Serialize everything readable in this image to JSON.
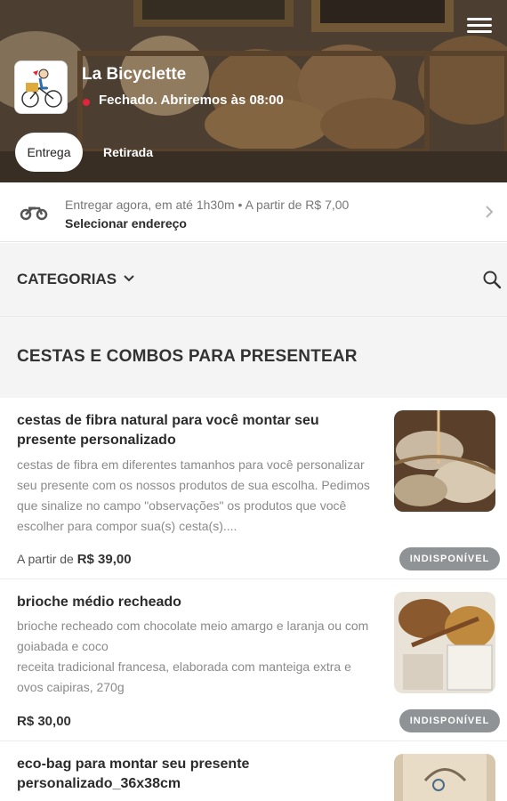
{
  "store": {
    "name": "La Bicyclette",
    "status": "Fechado. Abriremos às 08:00",
    "status_color": "#e2243b"
  },
  "modes": {
    "delivery": "Entrega",
    "pickup": "Retirada"
  },
  "delivery_info": {
    "line1": "Entregar agora, em até 1h30m  •  A partir de R$ 7,00",
    "line2": "Selecionar endereço"
  },
  "categories": {
    "label": "CATEGORIAS"
  },
  "section": {
    "title": "CESTAS E COMBOS PARA PRESENTEAR"
  },
  "products": [
    {
      "title": "cestas de fibra natural para você montar seu presente personalizado",
      "description": "cestas de fibra em diferentes tamanhos para você personalizar seu presente com os nossos produtos de sua escolha. Pedimos que sinalize no campo \"observações\" os produtos que você escolher para compor sua(s) cesta(s)....",
      "price_prefix": "A partir de",
      "price": "R$ 39,00",
      "badge": "INDISPONÍVEL"
    },
    {
      "title": "brioche médio recheado",
      "description": "brioche recheado com chocolate meio amargo e laranja ou com goiabada e coco\nreceita tradicional francesa, elaborada com manteiga extra e ovos caipiras, 270g",
      "price_prefix": "",
      "price": "R$ 30,00",
      "badge": "INDISPONÍVEL"
    },
    {
      "title": "eco-bag para montar seu presente personalizado_36x38cm"
    }
  ],
  "colors": {
    "accent_red": "#e2243b",
    "badge_gray": "#8f9396",
    "section_bg": "#f4f4f4"
  }
}
